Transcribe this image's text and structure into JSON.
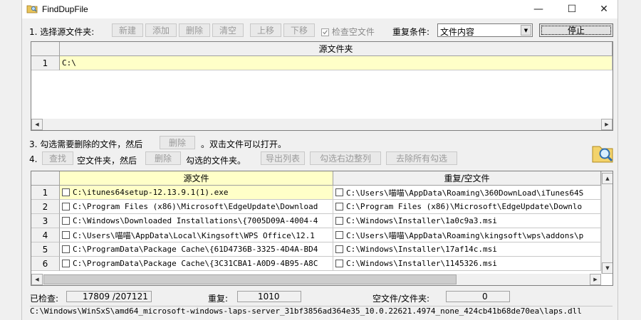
{
  "window": {
    "title": "FindDupFile"
  },
  "winbtns": {
    "min": "—",
    "max": "☐",
    "close": "✕"
  },
  "row1": {
    "label": "1. 选择源文件夹:",
    "buttons": [
      "新建",
      "添加",
      "删除",
      "清空",
      "上移",
      "下移"
    ],
    "check_empty_label": "检查空文件",
    "condition_label": "重复条件:",
    "condition_value": "文件内容",
    "stop_button": "停止"
  },
  "source_grid": {
    "header": "源文件夹",
    "rows": [
      {
        "num": "1",
        "path": "C:\\"
      }
    ]
  },
  "row3": {
    "prefix": "3. 勾选需要删除的文件，然后",
    "delete_button": "删除",
    "suffix": "。双击文件可以打开。"
  },
  "row4": {
    "prefix": "4.",
    "find_button": "查找",
    "mid_text": "空文件夹，然后",
    "delete_button": "删除",
    "after_text": "勾选的文件夹。",
    "export_button": "导出列表",
    "check_right_button": "勾选右边整列",
    "clear_all_button": "去除所有勾选"
  },
  "result_grid": {
    "headers": [
      "源文件",
      "重复/空文件"
    ],
    "rows": [
      {
        "num": "1",
        "src": "C:\\itunes64setup-12.13.9.1(1).exe",
        "dup": "C:\\Users\\喵喵\\AppData\\Roaming\\360DownLoad\\iTunes64S"
      },
      {
        "num": "2",
        "src": "C:\\Program Files (x86)\\Microsoft\\EdgeUpdate\\Download",
        "dup": "C:\\Program Files (x86)\\Microsoft\\EdgeUpdate\\Downlo"
      },
      {
        "num": "3",
        "src": "C:\\Windows\\Downloaded Installations\\{7005D09A-4004-4",
        "dup": "C:\\Windows\\Installer\\1a0c9a3.msi"
      },
      {
        "num": "4",
        "src": "C:\\Users\\喵喵\\AppData\\Local\\Kingsoft\\WPS Office\\12.1",
        "dup": "C:\\Users\\喵喵\\AppData\\Roaming\\kingsoft\\wps\\addons\\p"
      },
      {
        "num": "5",
        "src": "C:\\ProgramData\\Package Cache\\{61D4736B-3325-4D4A-BD4",
        "dup": "C:\\Windows\\Installer\\17af14c.msi"
      },
      {
        "num": "6",
        "src": "C:\\ProgramData\\Package Cache\\{3C31CBA1-A0D9-4B95-A8C",
        "dup": "C:\\Windows\\Installer\\1145326.msi"
      }
    ]
  },
  "status": {
    "checked_label": "已检查:",
    "checked_value": "17809 /207121",
    "dup_label": "重复:",
    "dup_value": "1010",
    "empty_label": "空文件/文件夹:",
    "empty_value": "0"
  },
  "current_path": "C:\\Windows\\WinSxS\\amd64_microsoft-windows-laps-server_31bf3856ad364e35_10.0.22621.4974_none_424cb41b68de70ea\\laps.dll",
  "colors": {
    "selected_row": "#ffffc8"
  },
  "icons": {
    "app": "folder-magnifier-icon",
    "search": "search-folder-icon"
  }
}
